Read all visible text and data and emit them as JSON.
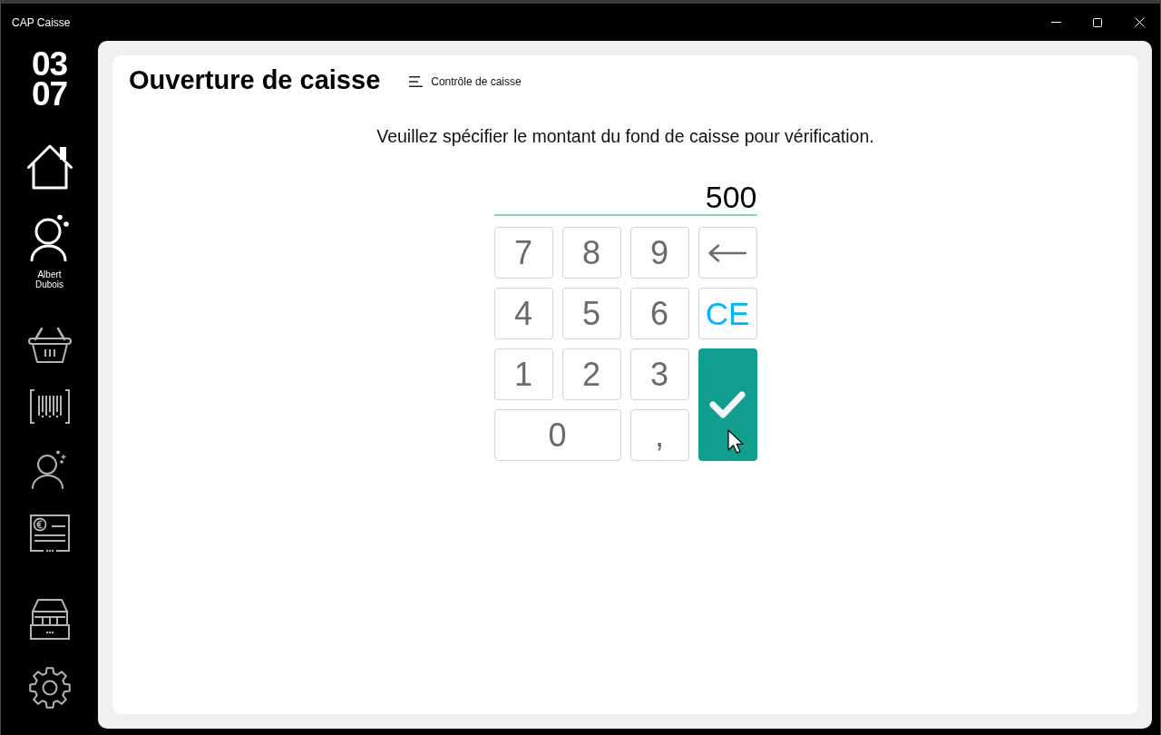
{
  "window": {
    "title": "CAP Caisse"
  },
  "sidebar": {
    "clock": {
      "hours": "03",
      "minutes": "07"
    },
    "top_items": [
      {
        "kind": "home",
        "selected": true
      }
    ],
    "user": {
      "name": "Albert Dubois"
    },
    "items": [
      {
        "kind": "basket",
        "selected": false
      },
      {
        "kind": "barcode",
        "selected": false
      },
      {
        "kind": "customer",
        "selected": false
      },
      {
        "kind": "statement",
        "selected": false
      }
    ],
    "bottom_items": [
      {
        "kind": "drawer",
        "selected": false
      },
      {
        "kind": "settings",
        "selected": false
      }
    ]
  },
  "page": {
    "title": "Ouverture de caisse",
    "menu_link": "Contrôle de caisse",
    "instruction": "Veuillez spécifier le montant du fond de caisse pour vérification."
  },
  "amount": {
    "value": "500"
  },
  "keypad": {
    "keys": [
      {
        "kind": "digit",
        "label": "7"
      },
      {
        "kind": "digit",
        "label": "8"
      },
      {
        "kind": "digit",
        "label": "9"
      },
      {
        "kind": "backspace"
      },
      {
        "kind": "digit",
        "label": "4"
      },
      {
        "kind": "digit",
        "label": "5"
      },
      {
        "kind": "digit",
        "label": "6"
      },
      {
        "kind": "clear",
        "label": "CE"
      },
      {
        "kind": "digit",
        "label": "1"
      },
      {
        "kind": "digit",
        "label": "2"
      },
      {
        "kind": "digit",
        "label": "3"
      },
      {
        "kind": "confirm"
      },
      {
        "kind": "wide",
        "label": "0"
      },
      {
        "kind": "digit",
        "label": ","
      }
    ]
  }
}
